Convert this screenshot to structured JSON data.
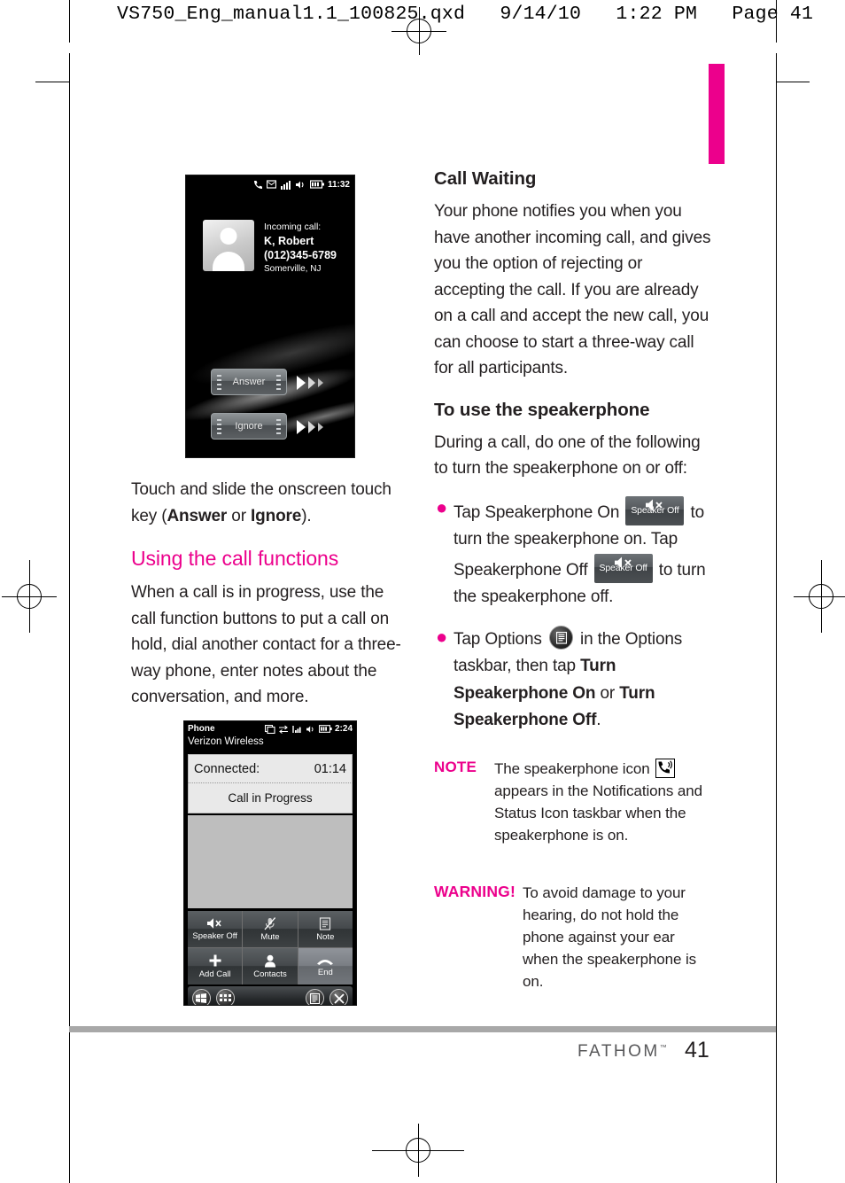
{
  "print_header": "VS750_Eng_manual1.1_100825.qxd   9/14/10   1:22 PM   Page 41",
  "left_column": {
    "caption": {
      "before": "Touch and slide the onscreen touch key (",
      "bold1": "Answer",
      "middle": " or ",
      "bold2": "Ignore",
      "after": ")."
    },
    "heading": "Using the call functions",
    "paragraph": "When a call is in progress, use the call function buttons to put a call on hold, dial another contact for a three-way phone, enter notes about the conversation, and more."
  },
  "right_column": {
    "heading1": "Call Waiting",
    "paragraph1": "Your phone notifies you when you have another incoming call, and gives you the option of rejecting or accepting the call. If you are already on a call and accept the new call, you can choose to start a three-way call for all participants.",
    "heading2": "To use the speakerphone",
    "paragraph2": "During a call, do one of the following to turn the speakerphone on or off:",
    "bullet1": {
      "part1": "Tap Speakerphone On ",
      "icon1_label": "Speaker Off",
      "part2": " to turn the speakerphone on. Tap Speakerphone Off ",
      "icon2_label": "Speaker Off",
      "part3": " to turn the speakerphone off."
    },
    "bullet2": {
      "part1": "Tap Options ",
      "part2": " in the Options taskbar, then tap ",
      "bold1": "Turn Speakerphone On",
      "mid": " or ",
      "bold2": "Turn Speakerphone Off",
      "end": "."
    },
    "note": {
      "label": "NOTE",
      "text_before": "The speakerphone icon ",
      "text_after": " appears in the Notifications and Status Icon taskbar when the speakerphone is on."
    },
    "warning": {
      "label": "WARNING!",
      "text": "To avoid damage to your hearing, do not hold the phone against your ear when the speakerphone is on."
    }
  },
  "phone_incoming": {
    "status_time": "11:32",
    "incoming_label": "Incoming call:",
    "caller_name": "K, Robert",
    "caller_number": "(012)345-6789",
    "caller_location": "Somerville, NJ",
    "answer_button": "Answer",
    "ignore_button": "Ignore"
  },
  "phone_connected": {
    "app_title": "Phone",
    "status_time": "2:24",
    "carrier": "Verizon Wireless",
    "connected_label": "Connected:",
    "call_duration": "01:14",
    "call_state": "Call in Progress",
    "buttons": [
      {
        "label": "Speaker Off",
        "icon": "speaker-mute-icon"
      },
      {
        "label": "Mute",
        "icon": "microphone-mute-icon"
      },
      {
        "label": "Note",
        "icon": "note-icon"
      },
      {
        "label": "Add Call",
        "icon": "plus-icon"
      },
      {
        "label": "Contacts",
        "icon": "person-icon"
      },
      {
        "label": "End",
        "icon": "end-call-icon"
      }
    ],
    "taskbar": [
      "start-icon",
      "keypad-icon",
      "options-icon",
      "close-icon"
    ]
  },
  "footer": {
    "brand": "FATHOM",
    "trademark": "™",
    "page_number": "41"
  },
  "colors": {
    "accent_pink": "#ec008c",
    "body_text": "#231f20",
    "rule_gray": "#a8a8a8"
  }
}
